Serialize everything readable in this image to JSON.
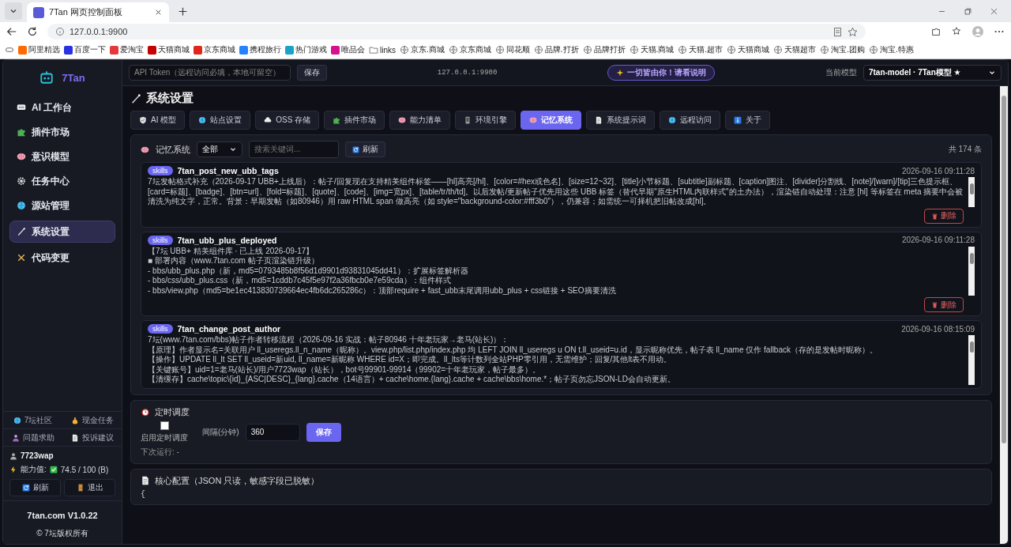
{
  "browser": {
    "tab_title": "7Tan 网页控制面板",
    "address": "127.0.0.1:9900",
    "bookmarks": [
      {
        "label": "阿里精选",
        "kind": "favicon",
        "color": "#ff6a00"
      },
      {
        "label": "百度一下",
        "kind": "favicon",
        "color": "#2932e1"
      },
      {
        "label": "爱淘宝",
        "kind": "favicon",
        "color": "#e4393c"
      },
      {
        "label": "天猫商城",
        "kind": "favicon",
        "color": "#c40000"
      },
      {
        "label": "京东商城",
        "kind": "favicon",
        "color": "#e1251b"
      },
      {
        "label": "携程旅行",
        "kind": "favicon",
        "color": "#2681ff"
      },
      {
        "label": "热门游戏",
        "kind": "favicon",
        "color": "#1aa3c8"
      },
      {
        "label": "唯品会",
        "kind": "favicon",
        "color": "#d6118d"
      },
      {
        "label": "links",
        "kind": "folder"
      },
      {
        "label": "京东.商城",
        "kind": "globe"
      },
      {
        "label": "京东商城",
        "kind": "globe"
      },
      {
        "label": "同花顺",
        "kind": "globe"
      },
      {
        "label": "品牌.打折",
        "kind": "globe"
      },
      {
        "label": "品牌打折",
        "kind": "globe"
      },
      {
        "label": "天猫.商城",
        "kind": "globe"
      },
      {
        "label": "天猫.超市",
        "kind": "globe"
      },
      {
        "label": "天猫商城",
        "kind": "globe"
      },
      {
        "label": "天猫超市",
        "kind": "globe"
      },
      {
        "label": "淘宝.团购",
        "kind": "globe"
      },
      {
        "label": "淘宝.特惠",
        "kind": "globe"
      }
    ]
  },
  "sidebar": {
    "brand": "7Tan",
    "items": [
      {
        "label": "AI 工作台",
        "selected": false
      },
      {
        "label": "插件市场",
        "selected": false
      },
      {
        "label": "意识模型",
        "selected": false
      },
      {
        "label": "任务中心",
        "selected": false
      },
      {
        "label": "源站管理",
        "selected": false
      },
      {
        "label": "系统设置",
        "selected": true
      },
      {
        "label": "代码变更",
        "selected": false
      }
    ],
    "links": [
      "7坛社区",
      "现金任务",
      "问题求助",
      "投诉建议"
    ],
    "user": "7723wap",
    "ability_label": "能力值:",
    "ability_value": "74.5 / 100 (B)",
    "buttons": [
      "刷新",
      "退出"
    ],
    "version": "7tan.com V1.0.22",
    "copyright": "© 7坛版权所有"
  },
  "header": {
    "token_placeholder": "API Token（远程访问必填，本地可留空）",
    "save": "保存",
    "host": "127.0.0.1:9900",
    "notice": "一切皆由你！请看说明",
    "model_label": "当前模型",
    "model": "7tan-model · 7Tan模型 ★"
  },
  "page_title": "系统设置",
  "tabs": [
    {
      "label": "AI 模型",
      "selected": false
    },
    {
      "label": "站点设置",
      "selected": false
    },
    {
      "label": "OSS 存储",
      "selected": false
    },
    {
      "label": "插件市场",
      "selected": false
    },
    {
      "label": "能力清单",
      "selected": false
    },
    {
      "label": "环境引擎",
      "selected": false
    },
    {
      "label": "记忆系统",
      "selected": true
    },
    {
      "label": "系统提示词",
      "selected": false
    },
    {
      "label": "远程访问",
      "selected": false
    },
    {
      "label": "关于",
      "selected": false
    }
  ],
  "memory": {
    "title": "记忆系统",
    "filter": "全部",
    "search_placeholder": "搜索关键词...",
    "refresh": "刷新",
    "total": "共 174 条",
    "entries": [
      {
        "tag": "skills",
        "title": "7tan_post_new_ubb_tags",
        "time": "2026-09-16 09:11:28",
        "lines": [
          "7坛发帖格式补充（2026-09-17 UBB+上线后）：帖子/回复现在支持精美组件标签——[hl]高亮[/hl]、[color=#hex或色名]、[size=12~32]、[title]小节标题、[subtitle]副标题、[caption]图注、[divider]分割线、[note]/[warn]/[tip]三色提示框、[card=标题]、[badge]、[btn=url]、[fold=标题]、[quote]、[code]、[img=宽px]、[table/tr/th/td]。以后发帖/更新帖子优先用这些 UBB 标签（替代早期\"原生HTML内联样式\"的土办法），渲染链自动处理：注意 [hl] 等标签在 meta 摘要中会被清洗为纯文字，正常。背景：早期发帖（如80946）用 raw HTML span 做高亮（如 style=\"background-color:#fff3b0\"），仍兼容；如需统一可择机把旧帖改成[hl]。"
        ],
        "delete_label": "删除"
      },
      {
        "tag": "skills",
        "title": "7tan_ubb_plus_deployed",
        "time": "2026-09-16 09:11:28",
        "lines": [
          "【7坛 UBB+ 精美组件库 · 已上线 2026-09-17】",
          "■ 部署内容（www.7tan.com 帖子页渲染链升级）",
          "- bbs/ubb_plus.php（新，md5=0793485b8f56d1d9901d93831045dd41）：扩展标签解析器",
          "- bbs/css/ubb_plus.css（新，md5=1cddb7c45f5e97f2a36fbcb0e7e59cda）：组件样式",
          "- bbs/view.php（md5=be1ec413830739664ec4fb6dc265286c）：顶部require + fast_ubb末尾调用ubb_plus + css链接 + SEO摘要清洗"
        ],
        "delete_label": "删除"
      },
      {
        "tag": "skills",
        "title": "7tan_change_post_author",
        "time": "2026-09-16 08:15:09",
        "lines": [
          "7坛(www.7tan.com/bbs)帖子作者转移流程（2026-09-16 实战：帖子80946 十年老玩家→老马(站长)）：",
          "【原理】作者显示名=关联用户 ll_useregs.ll_n_name（昵称）。view.php/list.php/index.php 均 LEFT JOIN ll_useregs u ON t.ll_useid=u.id，显示昵称优先，帖子表 ll_name 仅作 fallback（存的是发帖时昵称）。",
          "【操作】UPDATE ll_lt SET ll_useid=新uid, ll_name=新昵称 WHERE id=X；即完成。ll_lts等计数列全站PHP零引用，无需维护；回复/其他lt表不用动。",
          "【关键账号】uid=1=老马(站长)/用户7723wap（站长），bot号99901-99914（99902=十年老玩家，帖子最多）。",
          "【清缓存】cache\\topic\\{id}_{ASC|DESC}_{lang}.cache（14语言）+ cache\\home.{lang}.cache + cache\\bbs\\home.*；帖子页勿忘JSON-LD会自动更新。"
        ]
      }
    ]
  },
  "scheduler": {
    "title": "定时调度",
    "enabled": false,
    "enable_label": "启用定时调度",
    "interval_label": "间隔(分钟)",
    "interval": "360",
    "save": "保存",
    "next_run": "下次运行: -"
  },
  "config": {
    "title": "核心配置（JSON 只读，敏感字段已脱敏）",
    "lines": [
      "{"
    ]
  }
}
